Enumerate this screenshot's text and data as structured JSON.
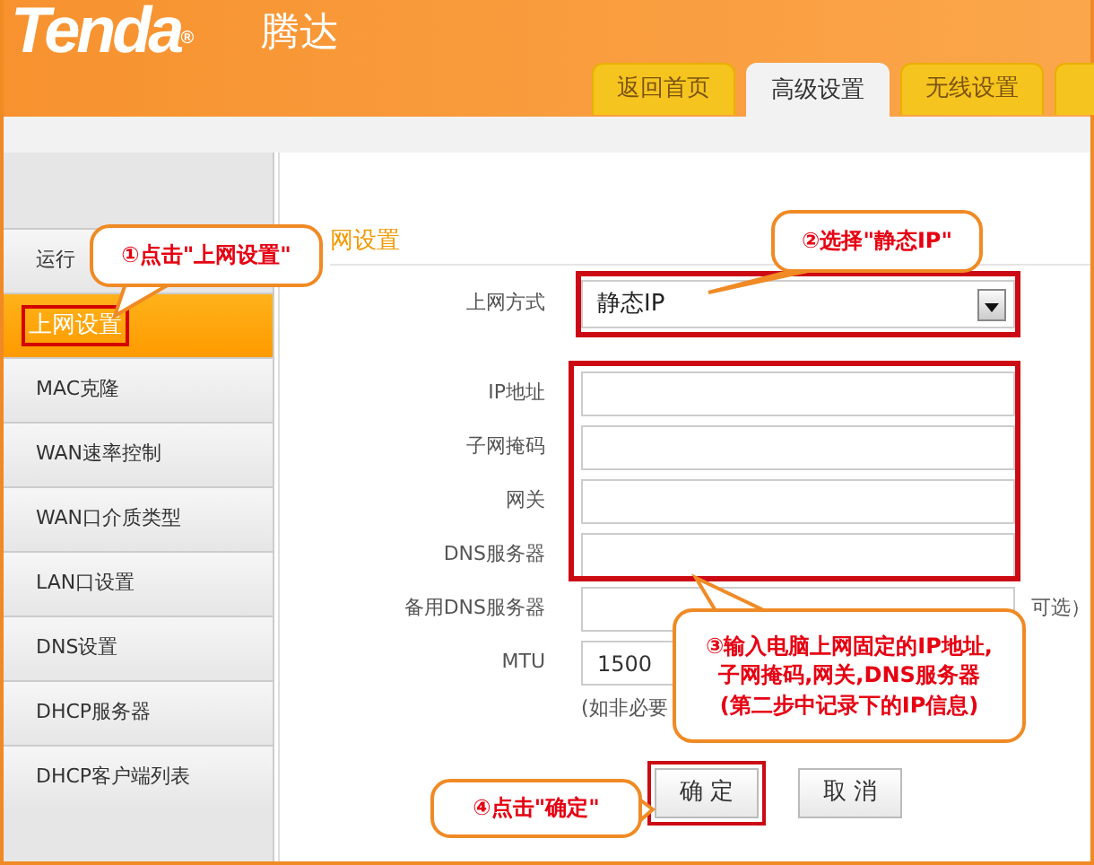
{
  "header": {
    "logo": "Tenda",
    "logo_mark": "®",
    "logo_cn": "腾达"
  },
  "tabs": [
    {
      "label": "返回首页",
      "selected": false
    },
    {
      "label": "高级设置",
      "selected": true
    },
    {
      "label": "无线设置",
      "selected": false
    },
    {
      "selected": false
    }
  ],
  "sidebar": {
    "items": [
      {
        "label": "运行",
        "selected": false,
        "framed": false
      },
      {
        "label": "上网设置",
        "selected": true,
        "framed": true
      },
      {
        "label": "MAC克隆",
        "selected": false,
        "framed": false
      },
      {
        "label": "WAN速率控制",
        "selected": false,
        "framed": false
      },
      {
        "label": "WAN口介质类型",
        "selected": false,
        "framed": false
      },
      {
        "label": "LAN口设置",
        "selected": false,
        "framed": false
      },
      {
        "label": "DNS设置",
        "selected": false,
        "framed": false
      },
      {
        "label": "DHCP服务器",
        "selected": false,
        "framed": false
      },
      {
        "label": "DHCP客户端列表",
        "selected": false,
        "framed": false
      }
    ]
  },
  "content": {
    "heading": "网设置",
    "connection": {
      "label": "上网方式",
      "value": "静态IP",
      "framed": true
    },
    "static_fields": {
      "framed": true,
      "fields": [
        {
          "label": "IP地址"
        },
        {
          "label": "子网掩码"
        },
        {
          "label": "网关"
        },
        {
          "label": "DNS服务器"
        }
      ]
    },
    "optional_fields": [
      {
        "label": "备用DNS服务器",
        "note": "可选）"
      },
      {
        "label": "MTU",
        "value": "1500"
      }
    ],
    "mtu_note": "(如非必要",
    "buttons": [
      {
        "label": "确 定",
        "framed": true
      },
      {
        "label": "取 消",
        "framed": false
      }
    ]
  },
  "callouts": [
    {
      "lines": [
        "①点击\"上网设置\""
      ]
    },
    {
      "lines": [
        "②选择\"静态IP\""
      ]
    },
    {
      "lines": [
        "③输入电脑上网固定的IP地址,",
        "子网掩码,网关,DNS服务器",
        "(第二步中记录下的IP信息)"
      ]
    },
    {
      "lines": [
        "④点击\"确定\""
      ]
    }
  ]
}
